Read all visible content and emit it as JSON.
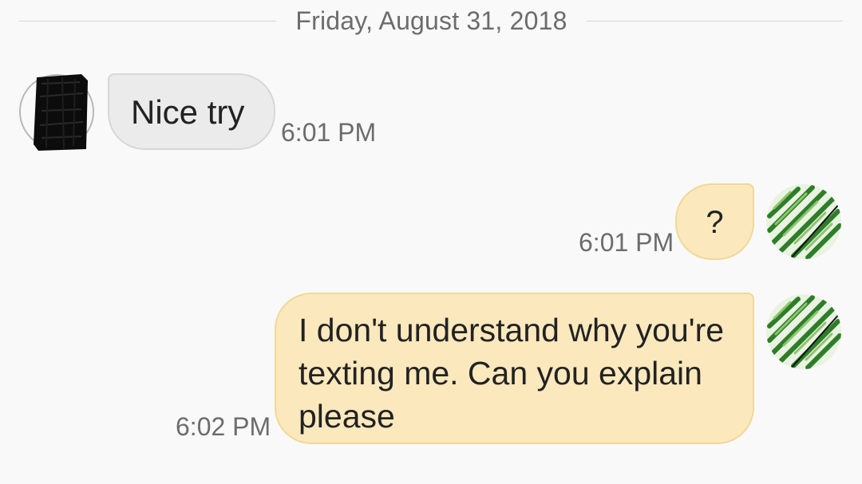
{
  "conversation": {
    "date_divider": "Friday, August 31, 2018",
    "messages": [
      {
        "direction": "incoming",
        "text": "Nice try",
        "time": "6:01 PM",
        "avatar_icon": "redacted-avatar-icon"
      },
      {
        "direction": "outgoing",
        "text": "?",
        "time": "6:01 PM",
        "avatar_icon": "fern-leaf-avatar-icon"
      },
      {
        "direction": "outgoing",
        "text": "I don't understand why you're texting me. Can you explain please",
        "time": "6:02 PM",
        "avatar_icon": "fern-leaf-avatar-icon"
      }
    ]
  },
  "colors": {
    "background": "#f9f9f9",
    "incoming_bubble": "#ebebeb",
    "outgoing_bubble": "#fbe9bd",
    "secondary_text": "#6c6c6c"
  }
}
